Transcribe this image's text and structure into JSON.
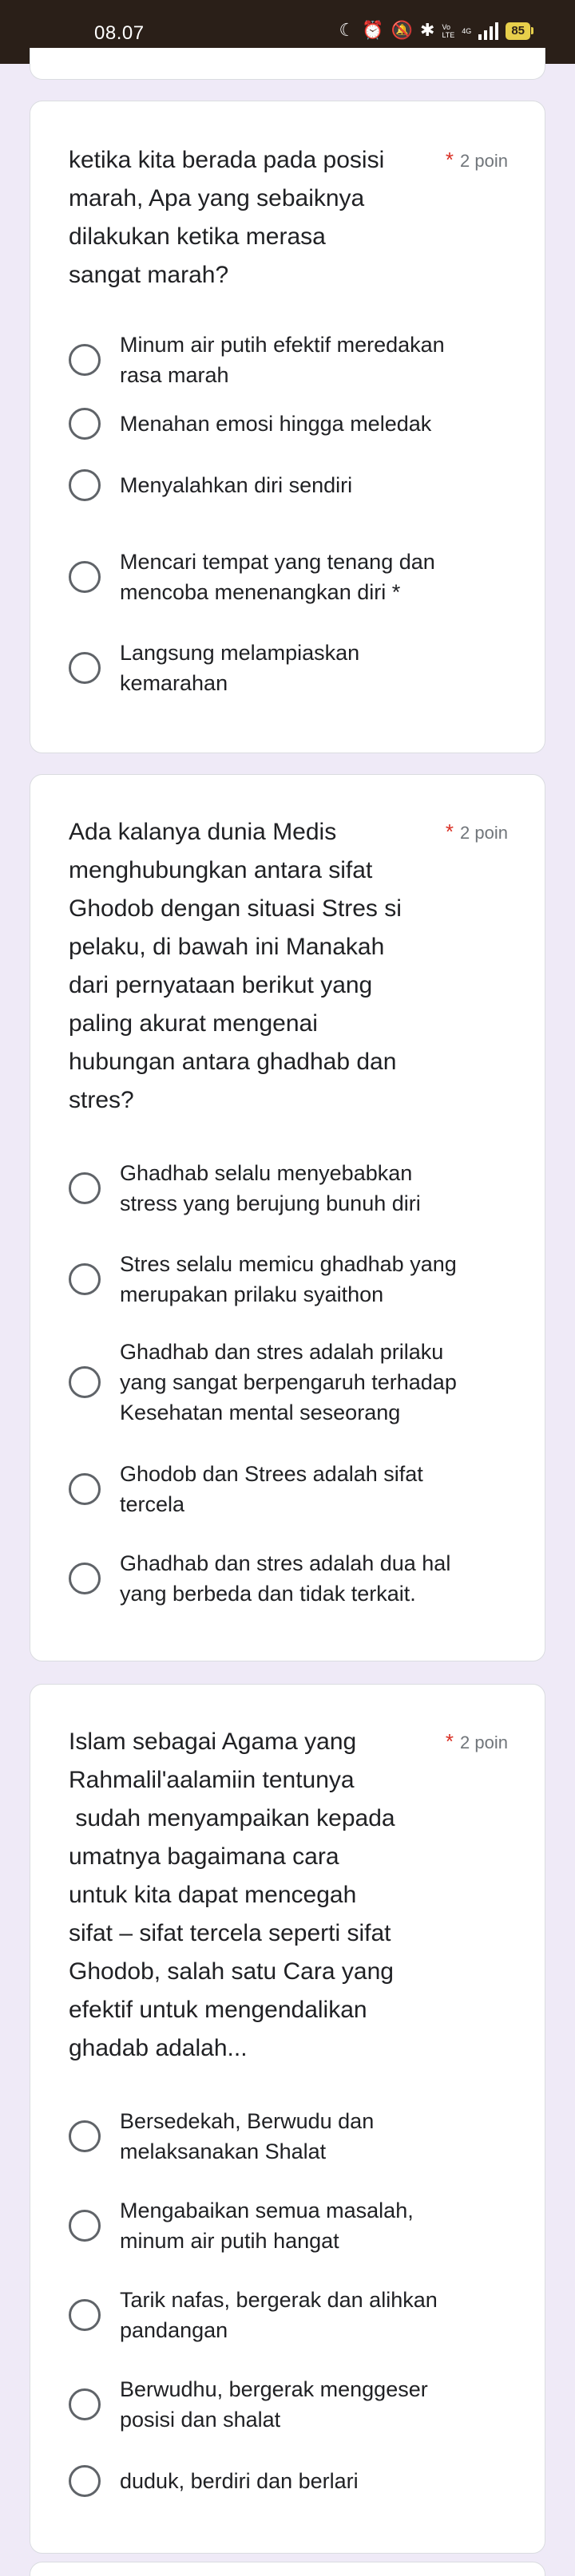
{
  "status_bar": {
    "time": "08.07",
    "icons": [
      "moon-icon",
      "alarm-icon",
      "bell-off-icon",
      "bluetooth-vibrate-icon",
      "volte-icon",
      "signal-4g-icon",
      "battery-icon"
    ],
    "network_top": "Vo",
    "network_bottom": "LTE",
    "network_4g": "4G",
    "battery": "85"
  },
  "colors": {
    "required_star": "#d93025",
    "status_bar_bg": "#2a1f18",
    "page_bg": "#efeaf7",
    "battery": "#e7cf4b"
  },
  "questions": [
    {
      "lines": [
        "ketika kita berada pada posisi",
        "marah, Apa yang sebaiknya",
        "dilakukan ketika merasa",
        "sangat marah?"
      ],
      "required_mark": "*",
      "points": "2 poin",
      "options": [
        [
          "Minum air putih efektif meredakan",
          "rasa marah"
        ],
        [
          "Menahan emosi hingga meledak"
        ],
        [
          "Menyalahkan diri sendiri"
        ],
        [
          "Mencari tempat yang tenang dan",
          "mencoba menenangkan diri *"
        ],
        [
          "Langsung melampiaskan",
          "kemarahan"
        ]
      ]
    },
    {
      "lines": [
        "Ada kalanya dunia Medis",
        "menghubungkan antara sifat",
        "Ghodob dengan situasi Stres si",
        "pelaku, di bawah ini Manakah",
        "dari pernyataan berikut yang",
        "paling akurat mengenai",
        "hubungan antara ghadhab dan",
        "stres?"
      ],
      "required_mark": "*",
      "points": "2 poin",
      "options": [
        [
          "Ghadhab selalu menyebabkan",
          "stress yang berujung bunuh diri"
        ],
        [
          "Stres selalu memicu ghadhab yang",
          "merupakan prilaku syaithon"
        ],
        [
          "Ghadhab dan stres  adalah prilaku",
          "yang sangat berpengaruh terhadap",
          "Kesehatan mental seseorang"
        ],
        [
          "Ghodob dan Strees adalah sifat",
          "tercela"
        ],
        [
          "Ghadhab dan stres adalah dua hal",
          "yang berbeda dan tidak terkait."
        ]
      ]
    },
    {
      "lines": [
        "Islam sebagai Agama yang",
        "Rahmalil'aalamiin  tentunya",
        " sudah menyampaikan kepada",
        "umatnya bagaimana  cara",
        "untuk kita dapat mencegah",
        "sifat – sifat tercela seperti sifat",
        "Ghodob, salah satu  Cara yang",
        "efektif untuk mengendalikan",
        "ghadab adalah..."
      ],
      "required_mark": "*",
      "points": "2 poin",
      "options": [
        [
          "Bersedekah, Berwudu dan",
          "melaksanakan Shalat"
        ],
        [
          "Mengabaikan semua masalah,",
          "minum air putih hangat"
        ],
        [
          "Tarik nafas, bergerak dan alihkan",
          "pandangan"
        ],
        [
          "Berwudhu, bergerak menggeser",
          "posisi dan shalat"
        ],
        [
          "duduk, berdiri dan berlari"
        ]
      ]
    }
  ]
}
